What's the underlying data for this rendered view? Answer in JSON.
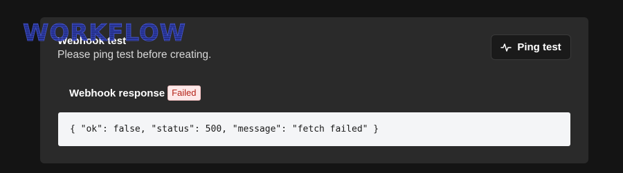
{
  "logo": {
    "text": "WORKFLOW",
    "color": "#2f3fb4"
  },
  "webhook_test": {
    "title": "Webhook test",
    "subtitle": "Please ping test before creating.",
    "ping_button": {
      "label": "Ping test",
      "icon": "activity-icon"
    }
  },
  "response": {
    "title": "Webhook response",
    "status_badge": "Failed",
    "status_color": "#b42318",
    "body": "{ \"ok\": false, \"status\": 500, \"message\": \"fetch failed\" }"
  }
}
